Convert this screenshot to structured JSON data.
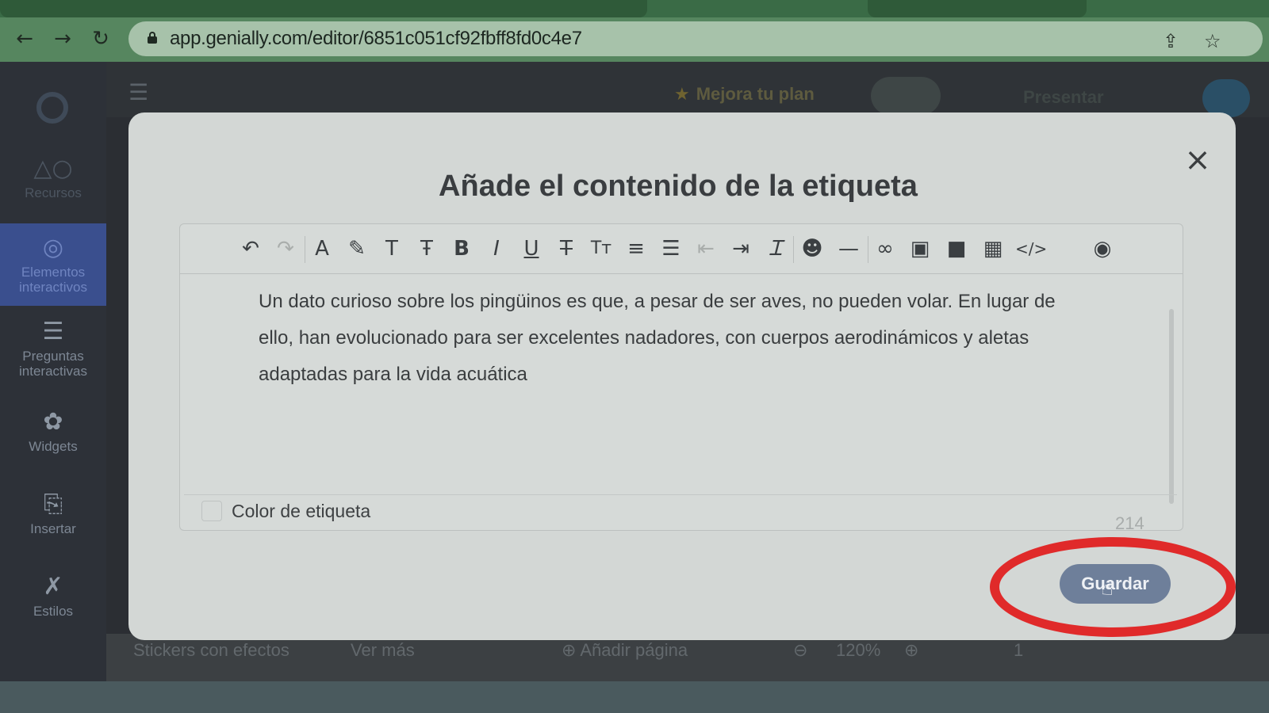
{
  "browser": {
    "url": "app.genially.com/editor/6851c051cf92fbff8fd0c4e7",
    "back_icon": "arrow-left-icon",
    "forward_icon": "arrow-right-icon",
    "reload_icon": "reload-icon",
    "share_icon": "share-icon",
    "bookmark_icon": "star-icon"
  },
  "sidebar": {
    "items": [
      {
        "label": "Recursos",
        "icon": "shapes-icon"
      },
      {
        "label": "Elementos interactivos",
        "icon": "pointer-icon"
      },
      {
        "label": "Preguntas interactivas",
        "icon": "checklist-icon"
      },
      {
        "label": "Widgets",
        "icon": "puzzle-icon"
      },
      {
        "label": "Insertar",
        "icon": "insert-icon"
      },
      {
        "label": "Estilos",
        "icon": "tools-icon"
      }
    ]
  },
  "topbar": {
    "plan_label": "Mejora tu plan",
    "present_label": "Presentar"
  },
  "bottombar": {
    "stickers_label": "Stickers con efectos",
    "more_label": "Ver más",
    "add_page_label": "Añadir página",
    "zoom": "120%",
    "page": "1"
  },
  "modal": {
    "title": "Añade el contenido de la etiqueta",
    "close_label": "×",
    "body_text": "Un dato curioso sobre los pingüinos es que, a pesar de ser aves, no pueden volar. En lugar de ello, han evolucionado para ser excelentes nadadores, con cuerpos aerodinámicos y aletas adaptadas para la vida acuática",
    "color_label": "Color de etiqueta",
    "char_count": "214",
    "save_label": "Guardar"
  },
  "colors": {
    "save_button": "#6e7f9a",
    "annotation_ring": "#e02a2a",
    "sidebar_active": "#3a4f8e"
  }
}
